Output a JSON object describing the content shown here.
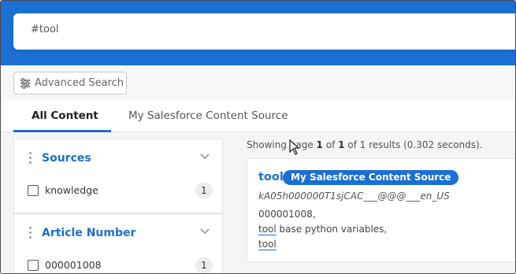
{
  "search": {
    "value": "#tool"
  },
  "advanced_search": {
    "label": "Advanced Search"
  },
  "tabs": [
    {
      "label": "All Content",
      "active": true
    },
    {
      "label": "My Salesforce Content Source",
      "active": false
    }
  ],
  "facets": [
    {
      "title": "Sources",
      "items": [
        {
          "label": "knowledge",
          "count": "1",
          "checked": false
        }
      ]
    },
    {
      "title": "Article Number",
      "items": [
        {
          "label": "000001008",
          "count": "1",
          "checked": false
        }
      ]
    }
  ],
  "summary": {
    "prefix": "Showing page ",
    "page": "1",
    "of_text": " of ",
    "total_pages": "1",
    "suffix": " of 1 results (0.302 seconds)."
  },
  "result": {
    "title": "tool",
    "source_badge": "My Salesforce Content Source",
    "uri": "kA05h000000T1sjCAC___@@@___en_US",
    "line1": "000001008,",
    "line2_hl": "tool",
    "line2_rest": " base python variables,",
    "line3_hl": "tool"
  },
  "colors": {
    "brand_blue": "#1b6fd3",
    "panel_bg": "#f5f5f6"
  }
}
